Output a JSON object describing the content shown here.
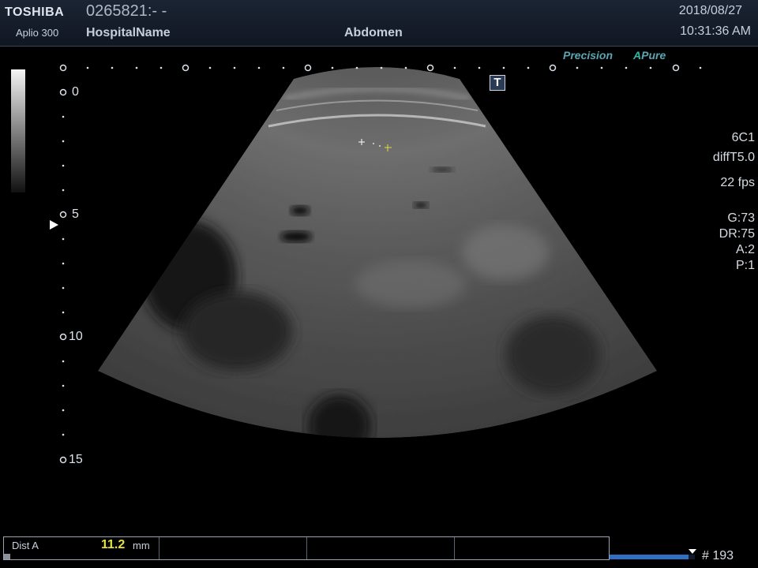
{
  "header": {
    "brand": "TOSHIBA",
    "model": "Aplio 300",
    "patient_id": "0265821:- -",
    "hospital": "HospitalName",
    "application": "Abdomen",
    "date": "2018/08/27",
    "time": "10:31:36 AM"
  },
  "image_modes": {
    "precision": "Precision",
    "apure_a": "A",
    "apure_rest": "Pure"
  },
  "tgc_button": "T",
  "probe": {
    "transducer": "6C1",
    "mode": "diffT5.0",
    "fps": "22 fps",
    "gain": "G:73",
    "dynamic_range": "DR:75",
    "acoustic": "A:2",
    "persistence": "P:1"
  },
  "depth_scale": {
    "labels": [
      "0",
      "5",
      "10",
      "15"
    ],
    "max_cm": 15
  },
  "measurement": {
    "label": "Dist A",
    "value": "11.2",
    "unit": "mm"
  },
  "cine": {
    "frame": "# 193",
    "progress_fraction": 0.93
  },
  "colors": {
    "header_bg": "#1b2433",
    "accent_teal": "#5aa6b3",
    "measure_yellow": "#e8e040",
    "cine_blue": "#2f6fc4"
  }
}
